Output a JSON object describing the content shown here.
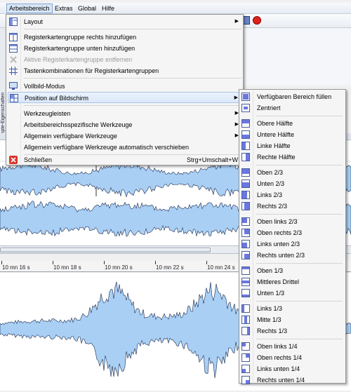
{
  "menubar": {
    "items": [
      "Arbeitsbereich",
      "Extras",
      "Global",
      "Hilfe"
    ]
  },
  "left_dock": {
    "tab_label": "Sample-Eigenschaften"
  },
  "ruler": {
    "labels": [
      "10 mn 16 s",
      "10 mn 18 s",
      "10 mn 20 s",
      "10 mn 22 s",
      "10 mn 24 s"
    ]
  },
  "menu": {
    "items": [
      {
        "label": "Layout",
        "icon": "layout-icon",
        "submenu": true
      },
      {
        "label": "Registerkartengruppe rechts hinzufügen",
        "icon": "tabgroup-right-icon"
      },
      {
        "label": "Registerkartengruppe unten hinzufügen",
        "icon": "tabgroup-bottom-icon"
      },
      {
        "label": "Aktive Registerkartengruppe entfernen",
        "icon": "remove-tabgroup-icon",
        "disabled": true
      },
      {
        "label": "Tastenkombinationen für Registerkartengruppen",
        "icon": "grid-icon"
      },
      {
        "label": "Vollbild-Modus",
        "icon": "monitor-icon"
      },
      {
        "label": "Position auf Bildschirm",
        "icon": "position-icon",
        "submenu": true,
        "highlighted": true
      },
      {
        "label": "Werkzeugleisten",
        "submenu": true
      },
      {
        "label": "Arbeitsbereichsspezifische Werkzeuge",
        "submenu": true
      },
      {
        "label": "Allgemein verfügbare Werkzeuge",
        "submenu": true
      },
      {
        "label": "Allgemein verfügbare Werkzeuge automatisch verschieben"
      },
      {
        "label": "Schließen",
        "icon": "close-icon",
        "shortcut": "Strg+Umschalt+W"
      }
    ]
  },
  "submenu": {
    "items": [
      {
        "label": "Verfügbaren Bereich füllen",
        "icon": "fill-area-icon"
      },
      {
        "label": "Zentriert",
        "icon": "centered-icon"
      },
      {
        "label": "Obere Hälfte",
        "icon": "top-half-icon"
      },
      {
        "label": "Untere Hälfte",
        "icon": "bottom-half-icon"
      },
      {
        "label": "Linke Hälfte",
        "icon": "left-half-icon"
      },
      {
        "label": "Rechte Hälfte",
        "icon": "right-half-icon"
      },
      {
        "label": "Oben 2/3",
        "icon": "top-two-thirds-icon"
      },
      {
        "label": "Unten 2/3",
        "icon": "bottom-two-thirds-icon"
      },
      {
        "label": "Links 2/3",
        "icon": "left-two-thirds-icon"
      },
      {
        "label": "Rechts 2/3",
        "icon": "right-two-thirds-icon"
      },
      {
        "label": "Oben links 2/3",
        "icon": "top-left-two-thirds-icon"
      },
      {
        "label": "Oben rechts 2/3",
        "icon": "top-right-two-thirds-icon"
      },
      {
        "label": "Links unten 2/3",
        "icon": "bottom-left-two-thirds-icon"
      },
      {
        "label": "Rechts unten 2/3",
        "icon": "bottom-right-two-thirds-icon"
      },
      {
        "label": "Oben 1/3",
        "icon": "top-third-icon"
      },
      {
        "label": "Mittleres Drittel",
        "icon": "middle-third-icon"
      },
      {
        "label": "Unten 1/3",
        "icon": "bottom-third-icon"
      },
      {
        "label": "Links 1/3",
        "icon": "left-third-icon"
      },
      {
        "label": "Mitte 1/3",
        "icon": "center-third-icon"
      },
      {
        "label": "Rechts 1/3",
        "icon": "right-third-icon"
      },
      {
        "label": "Oben links 1/4",
        "icon": "top-left-quarter-icon"
      },
      {
        "label": "Oben rechts 1/4",
        "icon": "top-right-quarter-icon"
      },
      {
        "label": "Links unten 1/4",
        "icon": "bottom-left-quarter-icon"
      },
      {
        "label": "Rechts unten 1/4",
        "icon": "bottom-right-quarter-icon"
      }
    ]
  },
  "colors": {
    "waveform_fill": "#a9cff5",
    "waveform_line": "#1c2a4a",
    "icon_fill": "#6a77e0",
    "highlight": "#dce9fa"
  }
}
